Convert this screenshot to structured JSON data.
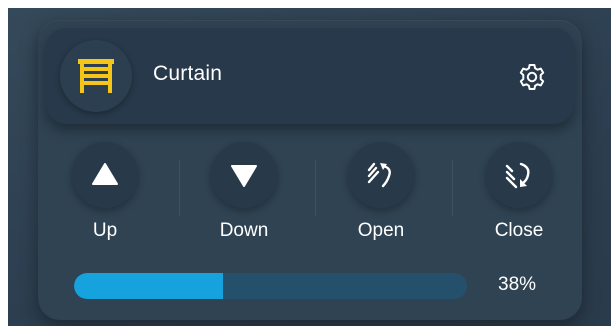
{
  "device": {
    "name": "Curtain",
    "icon": "curtain-icon",
    "icon_color": "#f5c518"
  },
  "settings": {
    "icon": "gear-icon"
  },
  "controls": [
    {
      "label": "Up",
      "icon": "triangle-up-icon"
    },
    {
      "label": "Down",
      "icon": "triangle-down-icon"
    },
    {
      "label": "Open",
      "icon": "open-icon"
    },
    {
      "label": "Close",
      "icon": "close-icon"
    }
  ],
  "position": {
    "value": 38,
    "display": "38%",
    "fill_color": "#16a3dd",
    "track_color": "#25506c"
  }
}
